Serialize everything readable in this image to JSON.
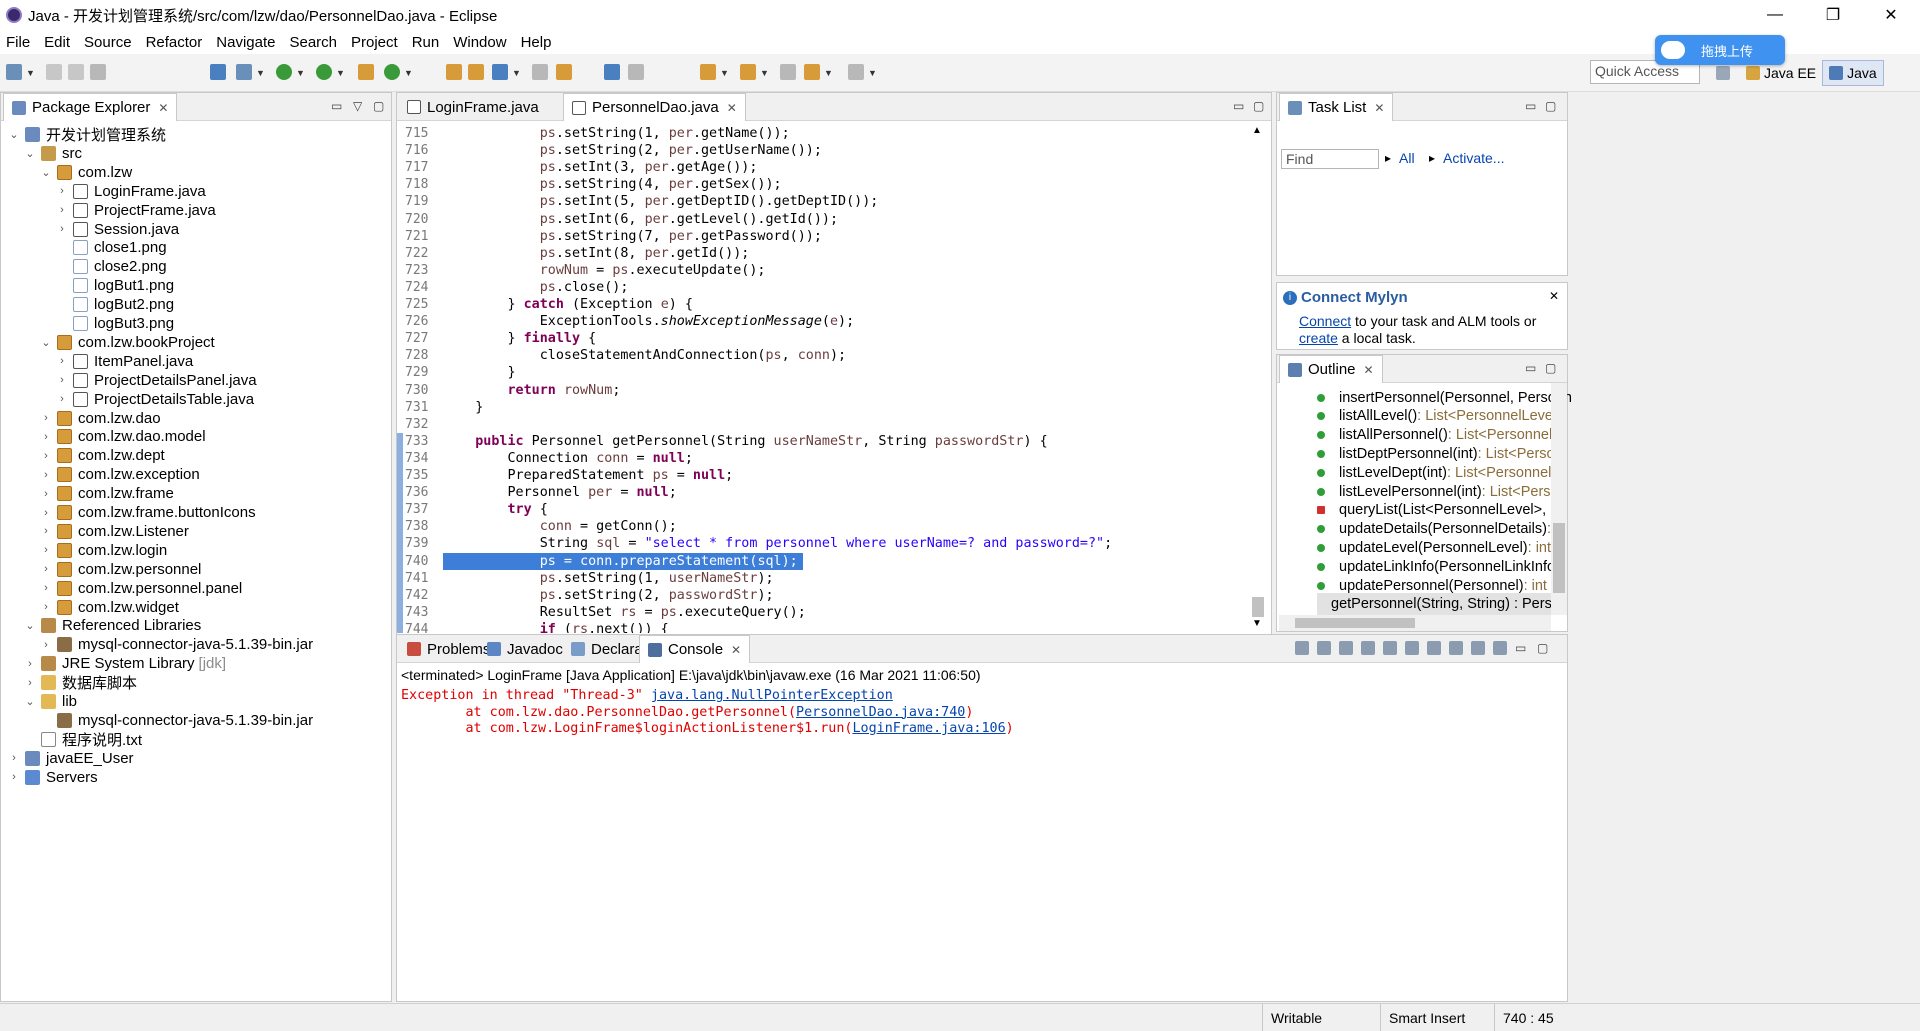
{
  "window": {
    "title": "Java - 开发计划管理系统/src/com/lzw/dao/PersonnelDao.java - Eclipse",
    "controls": [
      "—",
      "❐",
      "✕"
    ]
  },
  "menu": [
    "File",
    "Edit",
    "Source",
    "Refactor",
    "Navigate",
    "Search",
    "Project",
    "Run",
    "Window",
    "Help"
  ],
  "toolbar": {
    "quick_access_placeholder": "Quick Access",
    "perspectives": [
      "Java EE",
      "Java"
    ],
    "upload_badge": "拖拽上传"
  },
  "package_explorer": {
    "tab_label": "Package Explorer",
    "items": [
      {
        "label": "开发计划管理系统",
        "icon": "project-icon",
        "level": 0,
        "twisty": "⌄"
      },
      {
        "label": "src",
        "icon": "source-folder-icon",
        "level": 1,
        "twisty": "⌄"
      },
      {
        "label": "com.lzw",
        "icon": "package-icon",
        "level": 2,
        "twisty": "⌄"
      },
      {
        "label": "LoginFrame.java",
        "icon": "java-file-icon",
        "level": 3,
        "twisty": "›"
      },
      {
        "label": "ProjectFrame.java",
        "icon": "java-file-icon",
        "level": 3,
        "twisty": "›"
      },
      {
        "label": "Session.java",
        "icon": "java-file-icon",
        "level": 3,
        "twisty": "›"
      },
      {
        "label": "close1.png",
        "icon": "image-file-icon",
        "level": 3,
        "twisty": ""
      },
      {
        "label": "close2.png",
        "icon": "image-file-icon",
        "level": 3,
        "twisty": ""
      },
      {
        "label": "logBut1.png",
        "icon": "image-file-icon",
        "level": 3,
        "twisty": ""
      },
      {
        "label": "logBut2.png",
        "icon": "image-file-icon",
        "level": 3,
        "twisty": ""
      },
      {
        "label": "logBut3.png",
        "icon": "image-file-icon",
        "level": 3,
        "twisty": ""
      },
      {
        "label": "com.lzw.bookProject",
        "icon": "package-icon",
        "level": 2,
        "twisty": "⌄"
      },
      {
        "label": "ItemPanel.java",
        "icon": "java-file-icon",
        "level": 3,
        "twisty": "›"
      },
      {
        "label": "ProjectDetailsPanel.java",
        "icon": "java-file-icon",
        "level": 3,
        "twisty": "›"
      },
      {
        "label": "ProjectDetailsTable.java",
        "icon": "java-file-icon",
        "level": 3,
        "twisty": "›"
      },
      {
        "label": "com.lzw.dao",
        "icon": "package-icon",
        "level": 2,
        "twisty": "›"
      },
      {
        "label": "com.lzw.dao.model",
        "icon": "package-icon",
        "level": 2,
        "twisty": "›"
      },
      {
        "label": "com.lzw.dept",
        "icon": "package-icon",
        "level": 2,
        "twisty": "›"
      },
      {
        "label": "com.lzw.exception",
        "icon": "package-icon",
        "level": 2,
        "twisty": "›"
      },
      {
        "label": "com.lzw.frame",
        "icon": "package-icon",
        "level": 2,
        "twisty": "›"
      },
      {
        "label": "com.lzw.frame.buttonIcons",
        "icon": "package-icon",
        "level": 2,
        "twisty": "›"
      },
      {
        "label": "com.lzw.Listener",
        "icon": "package-icon",
        "level": 2,
        "twisty": "›"
      },
      {
        "label": "com.lzw.login",
        "icon": "package-icon",
        "level": 2,
        "twisty": "›"
      },
      {
        "label": "com.lzw.personnel",
        "icon": "package-icon",
        "level": 2,
        "twisty": "›"
      },
      {
        "label": "com.lzw.personnel.panel",
        "icon": "package-icon",
        "level": 2,
        "twisty": "›"
      },
      {
        "label": "com.lzw.widget",
        "icon": "package-icon",
        "level": 2,
        "twisty": "›"
      },
      {
        "label": "Referenced Libraries",
        "icon": "library-icon",
        "level": 1,
        "twisty": "⌄"
      },
      {
        "label": "mysql-connector-java-5.1.39-bin.jar",
        "icon": "jar-icon",
        "level": 2,
        "twisty": "›"
      },
      {
        "label": "JRE System Library",
        "suffix": "[jdk]",
        "icon": "library-icon",
        "level": 1,
        "twisty": "›"
      },
      {
        "label": "数据库脚本",
        "icon": "folder-icon",
        "level": 1,
        "twisty": "›"
      },
      {
        "label": "lib",
        "icon": "folder-icon",
        "level": 1,
        "twisty": "⌄"
      },
      {
        "label": "mysql-connector-java-5.1.39-bin.jar",
        "icon": "jar-icon",
        "level": 2,
        "twisty": ""
      },
      {
        "label": "程序说明.txt",
        "icon": "text-file-icon",
        "level": 1,
        "twisty": ""
      },
      {
        "label": "javaEE_User",
        "icon": "project-icon",
        "level": 0,
        "twisty": "›"
      },
      {
        "label": "Servers",
        "icon": "server-icon",
        "level": 0,
        "twisty": "›"
      }
    ]
  },
  "editor": {
    "tabs": [
      {
        "label": "LoginFrame.java",
        "active": false
      },
      {
        "label": "PersonnelDao.java",
        "active": true
      }
    ],
    "lines": [
      {
        "n": "715",
        "html": "            <span class=\"var\">ps</span>.setString(1, <span class=\"var\">per</span>.getName());"
      },
      {
        "n": "716",
        "html": "            <span class=\"var\">ps</span>.setString(2, <span class=\"var\">per</span>.getUserName());"
      },
      {
        "n": "717",
        "html": "            <span class=\"var\">ps</span>.setInt(3, <span class=\"var\">per</span>.getAge());"
      },
      {
        "n": "718",
        "html": "            <span class=\"var\">ps</span>.setString(4, <span class=\"var\">per</span>.getSex());"
      },
      {
        "n": "719",
        "html": "            <span class=\"var\">ps</span>.setInt(5, <span class=\"var\">per</span>.getDeptID().getDeptID());"
      },
      {
        "n": "720",
        "html": "            <span class=\"var\">ps</span>.setInt(6, <span class=\"var\">per</span>.getLevel().getId());"
      },
      {
        "n": "721",
        "html": "            <span class=\"var\">ps</span>.setString(7, <span class=\"var\">per</span>.getPassword());"
      },
      {
        "n": "722",
        "html": "            <span class=\"var\">ps</span>.setInt(8, <span class=\"var\">per</span>.getId());"
      },
      {
        "n": "723",
        "html": "            <span class=\"var\">rowNum</span> = <span class=\"var\">ps</span>.executeUpdate();"
      },
      {
        "n": "724",
        "html": "            <span class=\"var\">ps</span>.close();"
      },
      {
        "n": "725",
        "html": "        } <span class=\"kw\">catch</span> (Exception <span class=\"var\">e</span>) {"
      },
      {
        "n": "726",
        "html": "            ExceptionTools.<span class=\"it\">showExceptionMessage</span>(<span class=\"var\">e</span>);"
      },
      {
        "n": "727",
        "html": "        } <span class=\"kw\">finally</span> {"
      },
      {
        "n": "728",
        "html": "            closeStatementAndConnection(<span class=\"var\">ps</span>, <span class=\"var\">conn</span>);"
      },
      {
        "n": "729",
        "html": "        }"
      },
      {
        "n": "730",
        "html": "        <span class=\"kw\">return</span> <span class=\"var\">rowNum</span>;"
      },
      {
        "n": "731",
        "html": "    }"
      },
      {
        "n": "732",
        "html": ""
      },
      {
        "n": "733",
        "html": "    <span class=\"kw\">public</span> Personnel getPersonnel(String <span class=\"var\">userNameStr</span>, String <span class=\"var\">passwordStr</span>) {"
      },
      {
        "n": "734",
        "html": "        Connection <span class=\"var\">conn</span> = <span class=\"kw\">null</span>;"
      },
      {
        "n": "735",
        "html": "        PreparedStatement <span class=\"var\">ps</span> = <span class=\"kw\">null</span>;"
      },
      {
        "n": "736",
        "html": "        Personnel <span class=\"var\">per</span> = <span class=\"kw\">null</span>;"
      },
      {
        "n": "737",
        "html": "        <span class=\"kw\">try</span> {"
      },
      {
        "n": "738",
        "html": "            <span class=\"var\">conn</span> = getConn();"
      },
      {
        "n": "739",
        "html": "            String <span class=\"var\">sql</span> = <span class=\"str\">\"select * from personnel where userName=? and password=?\"</span>;"
      },
      {
        "n": "740",
        "html": "            <span class=\"var\">ps</span> = <span class=\"var\">conn</span>.prepareStatement(<span class=\"var\">sql</span>);",
        "selected": true
      },
      {
        "n": "741",
        "html": "            <span class=\"var\">ps</span>.setString(1, <span class=\"var\">userNameStr</span>);"
      },
      {
        "n": "742",
        "html": "            <span class=\"var\">ps</span>.setString(2, <span class=\"var\">passwordStr</span>);"
      },
      {
        "n": "743",
        "html": "            ResultSet <span class=\"var\">rs</span> = <span class=\"var\">ps</span>.executeQuery();"
      },
      {
        "n": "744",
        "html": "            <span class=\"kw\">if</span> (<span class=\"var\">rs</span>.next()) {"
      }
    ]
  },
  "task_list": {
    "tab_label": "Task List",
    "find_placeholder": "Find",
    "filter_all": "All",
    "activate": "Activate..."
  },
  "mylyn": {
    "title": "Connect Mylyn",
    "connect_link": "Connect",
    "text1": " to your task and ALM tools or",
    "create_link": "create",
    "text2": " a local task."
  },
  "outline": {
    "tab_label": "Outline",
    "items": [
      {
        "name": "insertPersonnel(Personnel, Personn",
        "ret": "",
        "marker": "green"
      },
      {
        "name": "listAllLevel()",
        "ret": " : List<PersonnelLevel>",
        "marker": "green"
      },
      {
        "name": "listAllPersonnel()",
        "ret": " : List<Personnel>",
        "marker": "green"
      },
      {
        "name": "listDeptPersonnel(int)",
        "ret": " : List<Person",
        "marker": "green"
      },
      {
        "name": "listLevelDept(int)",
        "ret": " : List<PersonnelL",
        "marker": "green"
      },
      {
        "name": "listLevelPersonnel(int)",
        "ret": " : List<Perso",
        "marker": "green"
      },
      {
        "name": "queryList(List<PersonnelLevel>, Pr",
        "ret": "",
        "marker": "red"
      },
      {
        "name": "updateDetails(PersonnelDetails)",
        "ret": " : in",
        "marker": "green"
      },
      {
        "name": "updateLevel(PersonnelLevel)",
        "ret": " : int",
        "marker": "green"
      },
      {
        "name": "updateLinkInfo(PersonnelLinkInfo)",
        "ret": "",
        "marker": "green"
      },
      {
        "name": "updatePersonnel(Personnel)",
        "ret": " : int",
        "marker": "green"
      },
      {
        "name": "getPersonnel(String, String) : Perso",
        "ret": "",
        "marker": "green",
        "selected": true
      }
    ]
  },
  "bottom": {
    "tabs": [
      "Problems",
      "Javadoc",
      "Declaration",
      "Console"
    ],
    "active_tab": "Console",
    "terminated": "<terminated> LoginFrame [Java Application] E:\\java\\jdk\\bin\\javaw.exe (16 Mar 2021 11:06:50)",
    "console": [
      {
        "pre": "Exception in thread \"Thread-3\" ",
        "link": "java.lang.NullPointerException",
        "post": ""
      },
      {
        "pre": "        at com.lzw.dao.PersonnelDao.getPersonnel(",
        "link": "PersonnelDao.java:740",
        "post": ")"
      },
      {
        "pre": "        at com.lzw.LoginFrame$loginActionListener$1.run(",
        "link": "LoginFrame.java:106",
        "post": ")"
      }
    ]
  },
  "status": {
    "writable": "Writable",
    "insert_mode": "Smart Insert",
    "position": "740 : 45"
  }
}
